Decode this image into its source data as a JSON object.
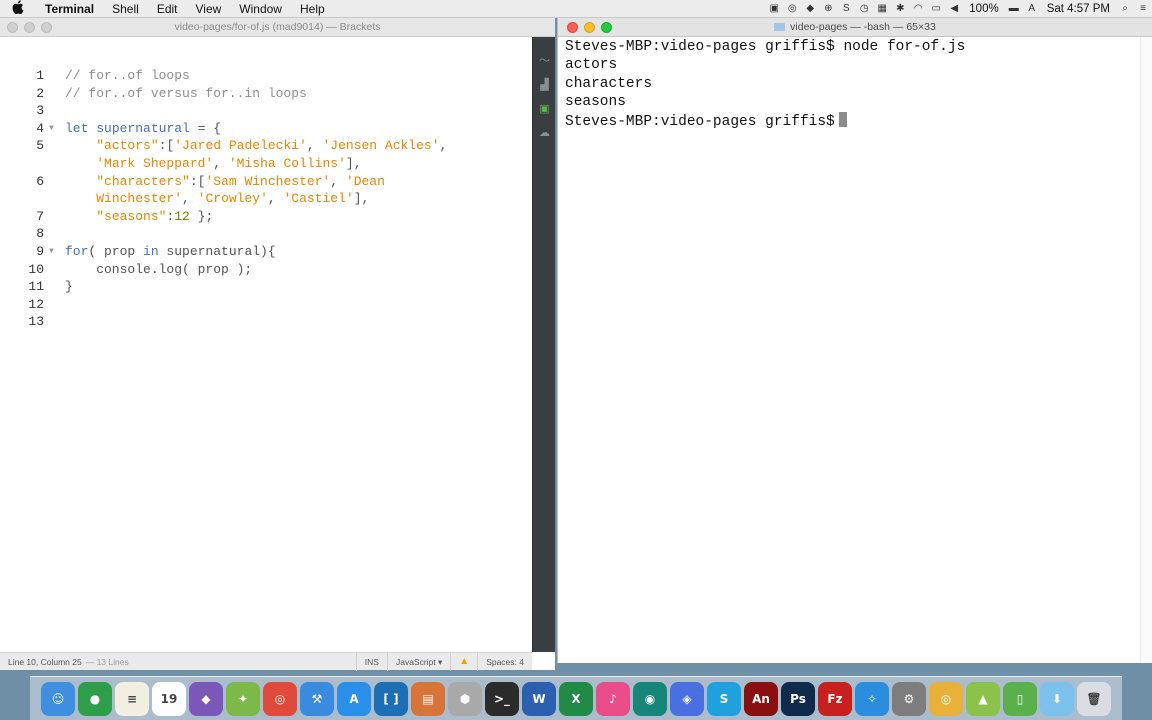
{
  "menubar": {
    "apple": "",
    "items": [
      "Terminal",
      "Shell",
      "Edit",
      "View",
      "Window",
      "Help"
    ],
    "battery": "100%",
    "clock": "Sat 4:57 PM"
  },
  "brackets": {
    "title": "video-pages/for-of.js (mad9014) — Brackets",
    "status": {
      "cursor": "Line 10, Column 25",
      "lines": "— 13 Lines",
      "mode": "INS",
      "language": "JavaScript ▾",
      "spaces": "Spaces: 4"
    },
    "code": [
      {
        "n": "1",
        "fold": "",
        "tokens": [
          [
            "com",
            "// for..of loops"
          ]
        ]
      },
      {
        "n": "2",
        "fold": "",
        "tokens": [
          [
            "com",
            "// for..of versus for..in loops"
          ]
        ]
      },
      {
        "n": "3",
        "fold": "",
        "tokens": []
      },
      {
        "n": "4",
        "fold": "▼",
        "tokens": [
          [
            "kw",
            "let "
          ],
          [
            "kw",
            "supernatural"
          ],
          [
            "plain",
            " = {"
          ]
        ]
      },
      {
        "n": "5",
        "fold": "",
        "tokens": [
          [
            "plain",
            "    "
          ],
          [
            "str",
            "\"actors\""
          ],
          [
            "plain",
            ":["
          ],
          [
            "str",
            "'Jared Padelecki'"
          ],
          [
            "plain",
            ", "
          ],
          [
            "str",
            "'Jensen Ackles'"
          ],
          [
            "plain",
            ","
          ]
        ]
      },
      {
        "n": "",
        "fold": "",
        "tokens": [
          [
            "plain",
            "    "
          ],
          [
            "str",
            "'Mark Sheppard'"
          ],
          [
            "plain",
            ", "
          ],
          [
            "str",
            "'Misha Collins'"
          ],
          [
            "plain",
            "],"
          ]
        ]
      },
      {
        "n": "6",
        "fold": "",
        "tokens": [
          [
            "plain",
            "    "
          ],
          [
            "str",
            "\"characters\""
          ],
          [
            "plain",
            ":["
          ],
          [
            "str",
            "'Sam Winchester'"
          ],
          [
            "plain",
            ", "
          ],
          [
            "str",
            "'Dean"
          ]
        ]
      },
      {
        "n": "",
        "fold": "",
        "tokens": [
          [
            "plain",
            "    "
          ],
          [
            "str",
            "Winchester'"
          ],
          [
            "plain",
            ", "
          ],
          [
            "str",
            "'Crowley'"
          ],
          [
            "plain",
            ", "
          ],
          [
            "str",
            "'Castiel'"
          ],
          [
            "plain",
            "],"
          ]
        ]
      },
      {
        "n": "7",
        "fold": "",
        "tokens": [
          [
            "plain",
            "    "
          ],
          [
            "str",
            "\"seasons\""
          ],
          [
            "plain",
            ":"
          ],
          [
            "num",
            "12"
          ],
          [
            "plain",
            " };"
          ]
        ]
      },
      {
        "n": "8",
        "fold": "",
        "tokens": []
      },
      {
        "n": "9",
        "fold": "▼",
        "tokens": [
          [
            "kw",
            "for"
          ],
          [
            "plain",
            "( prop "
          ],
          [
            "kw",
            "in"
          ],
          [
            "plain",
            " supernatural){"
          ]
        ]
      },
      {
        "n": "10",
        "fold": "",
        "tokens": [
          [
            "plain",
            "    console.log( prop );"
          ]
        ]
      },
      {
        "n": "11",
        "fold": "",
        "tokens": [
          [
            "plain",
            "}"
          ]
        ]
      },
      {
        "n": "12",
        "fold": "",
        "tokens": []
      },
      {
        "n": "13",
        "fold": "",
        "tokens": []
      }
    ]
  },
  "terminal": {
    "title": "video-pages — -bash — 65×33",
    "lines": [
      "Steves-MBP:video-pages griffis$ node for-of.js",
      "actors",
      "characters",
      "seasons",
      "Steves-MBP:video-pages griffis$"
    ]
  },
  "dock": [
    {
      "name": "finder-icon",
      "color": "#3f8fe0",
      "glyph": "☺"
    },
    {
      "name": "mongodb-icon",
      "color": "#2f9e4a",
      "glyph": "●"
    },
    {
      "name": "notes-icon",
      "color": "#f2efe2",
      "glyph": "≡"
    },
    {
      "name": "calendar-icon",
      "color": "#ffffff",
      "glyph": "19"
    },
    {
      "name": "github-icon",
      "color": "#7a57b8",
      "glyph": "◆"
    },
    {
      "name": "android-studio-icon",
      "color": "#7cb94a",
      "glyph": "✦"
    },
    {
      "name": "chrome-icon",
      "color": "#e04a3b",
      "glyph": "◎"
    },
    {
      "name": "xcode-icon",
      "color": "#3a8be0",
      "glyph": "⚒"
    },
    {
      "name": "app-store-icon",
      "color": "#2a8fe8",
      "glyph": "A"
    },
    {
      "name": "brackets-icon",
      "color": "#1d6fb5",
      "glyph": "[ ]"
    },
    {
      "name": "books-icon",
      "color": "#d6743a",
      "glyph": "▤"
    },
    {
      "name": "sequel-icon",
      "color": "#a9a9a9",
      "glyph": "⬢"
    },
    {
      "name": "terminal-icon",
      "color": "#2b2b2b",
      "glyph": ">_"
    },
    {
      "name": "word-icon",
      "color": "#2c5fb0",
      "glyph": "W"
    },
    {
      "name": "excel-icon",
      "color": "#208a46",
      "glyph": "X"
    },
    {
      "name": "itunes-icon",
      "color": "#e84d8a",
      "glyph": "♪"
    },
    {
      "name": "gitkraken-icon",
      "color": "#17867a",
      "glyph": "◉"
    },
    {
      "name": "discord-icon",
      "color": "#4a6fe0",
      "glyph": "◈"
    },
    {
      "name": "skype-icon",
      "color": "#21a0e0",
      "glyph": "S"
    },
    {
      "name": "animate-icon",
      "color": "#8a0f10",
      "glyph": "An"
    },
    {
      "name": "photoshop-icon",
      "color": "#0f2a4a",
      "glyph": "Ps"
    },
    {
      "name": "filezilla-icon",
      "color": "#c8201e",
      "glyph": "Fz"
    },
    {
      "name": "safari-icon",
      "color": "#2a8de0",
      "glyph": "✧"
    },
    {
      "name": "system-preferences-icon",
      "color": "#7d7d7d",
      "glyph": "⚙"
    },
    {
      "name": "chrome-canary-icon",
      "color": "#e8b23a",
      "glyph": "◎"
    },
    {
      "name": "android-icon",
      "color": "#8bc34a",
      "glyph": "▲"
    },
    {
      "name": "notepad-icon",
      "color": "#5ab04a",
      "glyph": "▯"
    },
    {
      "name": "downloads-icon",
      "color": "#7cc0ec",
      "glyph": "⬇"
    },
    {
      "name": "trash-icon",
      "color": "#d9dde2",
      "glyph": "🗑"
    }
  ]
}
